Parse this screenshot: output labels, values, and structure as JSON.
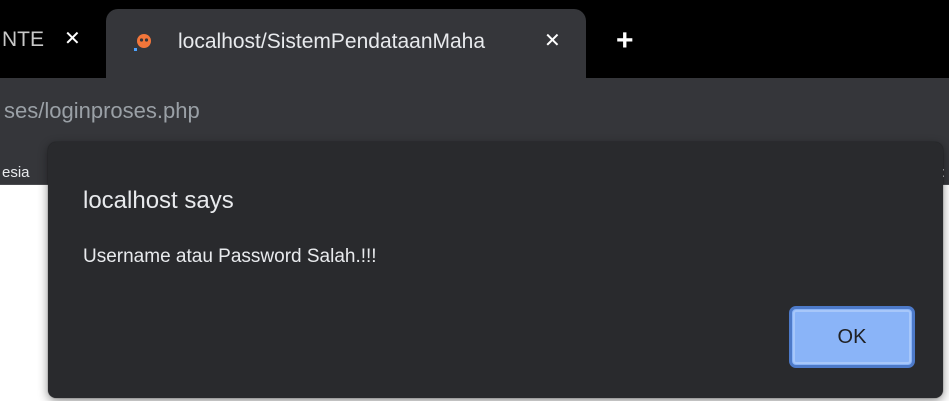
{
  "browser": {
    "tabs": [
      {
        "title": "NTE",
        "close": "✕"
      },
      {
        "title": "localhost/SistemPendataanMaha",
        "close": "✕",
        "favicon": "xampp-icon"
      }
    ],
    "new_tab": "+",
    "address_bar": {
      "url": "ses/loginproses.php"
    },
    "bookmarks": [
      {
        "label": "esia"
      }
    ],
    "bookmarks_overflow": ":"
  },
  "dialog": {
    "title": "localhost says",
    "message": "Username atau Password Salah.!!!",
    "ok_label": "OK"
  },
  "colors": {
    "tabstrip": "#000000",
    "toolbar": "#35363a",
    "dialog_bg": "#292a2d",
    "ok_button": "#8ab4f8",
    "favicon": "#f2763a"
  }
}
